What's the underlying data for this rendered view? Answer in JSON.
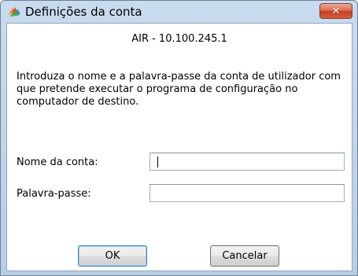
{
  "window": {
    "title": "Definições da conta",
    "close_symbol": "✕",
    "app_icon": "avg-logo-icon",
    "close_icon": "close-icon"
  },
  "dialog": {
    "host": "AIR - 10.100.245.1",
    "description": "Introduza o nome e a palavra-passe da conta de utilizador com que pretende executar o programa de configuração no computador de destino.",
    "account_label": "Nome da conta:",
    "account_value": "",
    "password_label": "Palavra-passe:",
    "password_value": "",
    "ok_label": "OK",
    "cancel_label": "Cancelar"
  },
  "colors": {
    "title_bar": "#c9dbef",
    "close_button": "#c84a2e",
    "default_button_border": "#3c7fb1"
  }
}
